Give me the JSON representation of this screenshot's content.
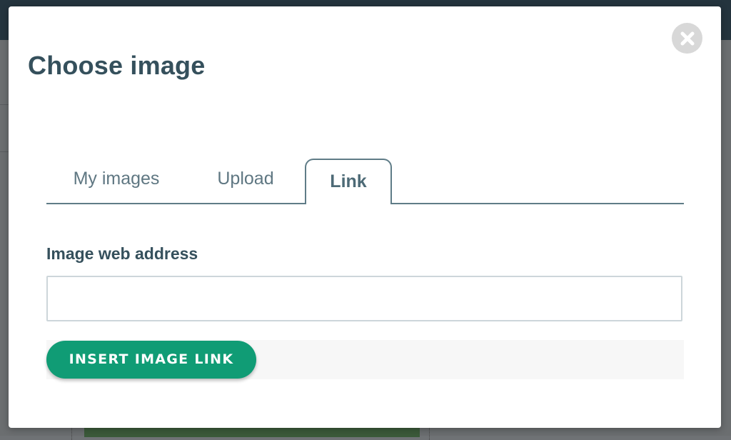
{
  "dialog": {
    "title": "Choose image",
    "close_icon": "close-x-circle-icon"
  },
  "tabs": [
    {
      "label": "My images",
      "active": false
    },
    {
      "label": "Upload",
      "active": false
    },
    {
      "label": "Link",
      "active": true
    }
  ],
  "form": {
    "field_label": "Image web address",
    "url_value": "",
    "url_placeholder": ""
  },
  "actions": {
    "insert_label": "INSERT IMAGE LINK"
  },
  "colors": {
    "accent": "#109c75",
    "title": "#35505c",
    "tab_border": "#5f7c87",
    "backdrop": "#6f7275"
  }
}
